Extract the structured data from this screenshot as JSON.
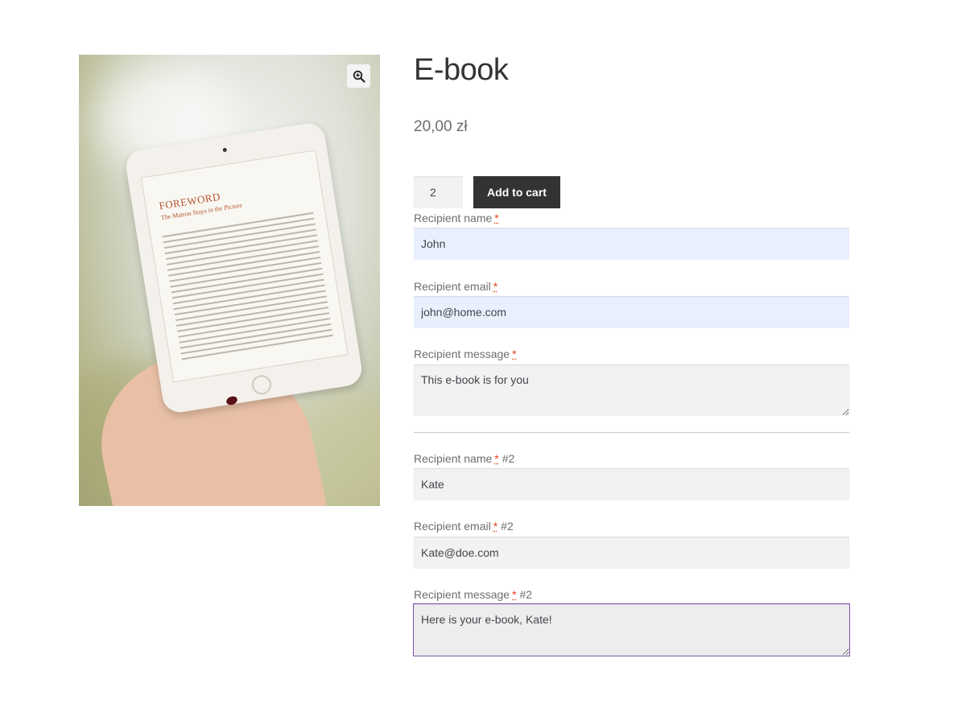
{
  "product": {
    "title": "E-book",
    "price": "20,00 zł",
    "quantity": "2",
    "add_to_cart_label": "Add to cart"
  },
  "gallery": {
    "image_heading": "FOREWORD",
    "image_subheading": "The Matron Stays in the Picture",
    "zoom_icon": "magnifier-plus-icon"
  },
  "recipients": [
    {
      "name_label": "Recipient name",
      "name_value": "John",
      "email_label": "Recipient email",
      "email_value": "john@home.com",
      "message_label": "Recipient message",
      "message_value": "This e-book is for you",
      "suffix": ""
    },
    {
      "name_label": "Recipient name",
      "name_value": "Kate",
      "email_label": "Recipient email",
      "email_value": "Kate@doe.com",
      "message_label": "Recipient message",
      "message_value": "Here is your e-book, Kate!",
      "suffix": "#2"
    }
  ],
  "required_marker": "*",
  "colors": {
    "button_bg": "#333333",
    "required": "#e2401c",
    "autofill_bg": "#e8f0fe",
    "focus_outline": "#7f54b3"
  }
}
